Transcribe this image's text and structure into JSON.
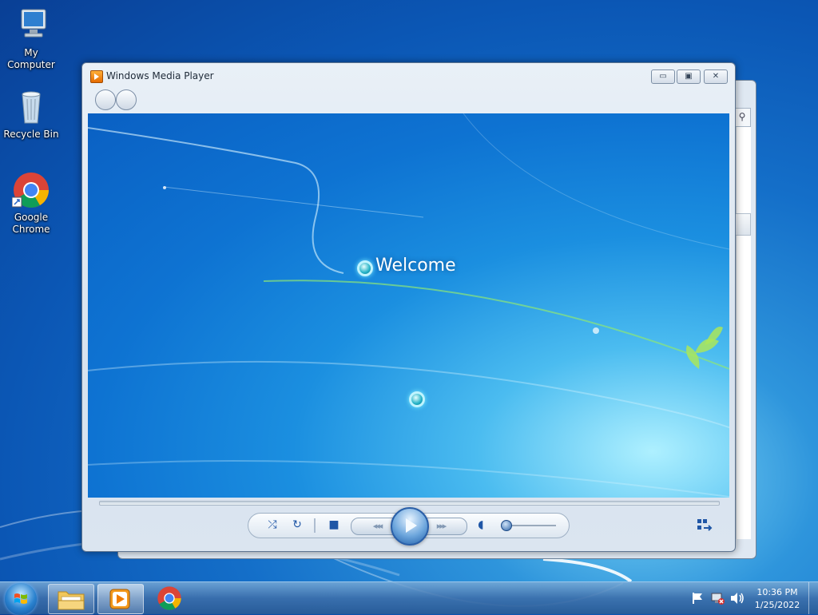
{
  "desktop": {
    "icons": [
      {
        "label": "My Computer",
        "icon": "computer-icon"
      },
      {
        "label": "Recycle Bin",
        "icon": "recycle-bin-icon"
      },
      {
        "label": "Google Chrome",
        "icon": "chrome-icon"
      }
    ]
  },
  "window": {
    "title": "Windows Media Player",
    "buttons": {
      "minimize": "▭",
      "maximize": "▣",
      "close": "✕"
    },
    "welcome_text": "Welcome"
  },
  "background_window": {
    "search_glyph": "⚲"
  },
  "controls": {
    "shuffle": "⤮",
    "repeat": "↻",
    "stop": "■",
    "previous": "◂◂◂",
    "next": "▸▸▸",
    "mute": "◖"
  },
  "taskbar": {
    "items": [
      "windows-explorer",
      "windows-media-player",
      "google-chrome"
    ],
    "tray": {
      "time": "10:36 PM",
      "date": "1/25/2022"
    }
  },
  "colors": {
    "desktop_blue": "#146fc9",
    "video_blue": "#1b8fe0",
    "accent": "#1f56a6"
  }
}
